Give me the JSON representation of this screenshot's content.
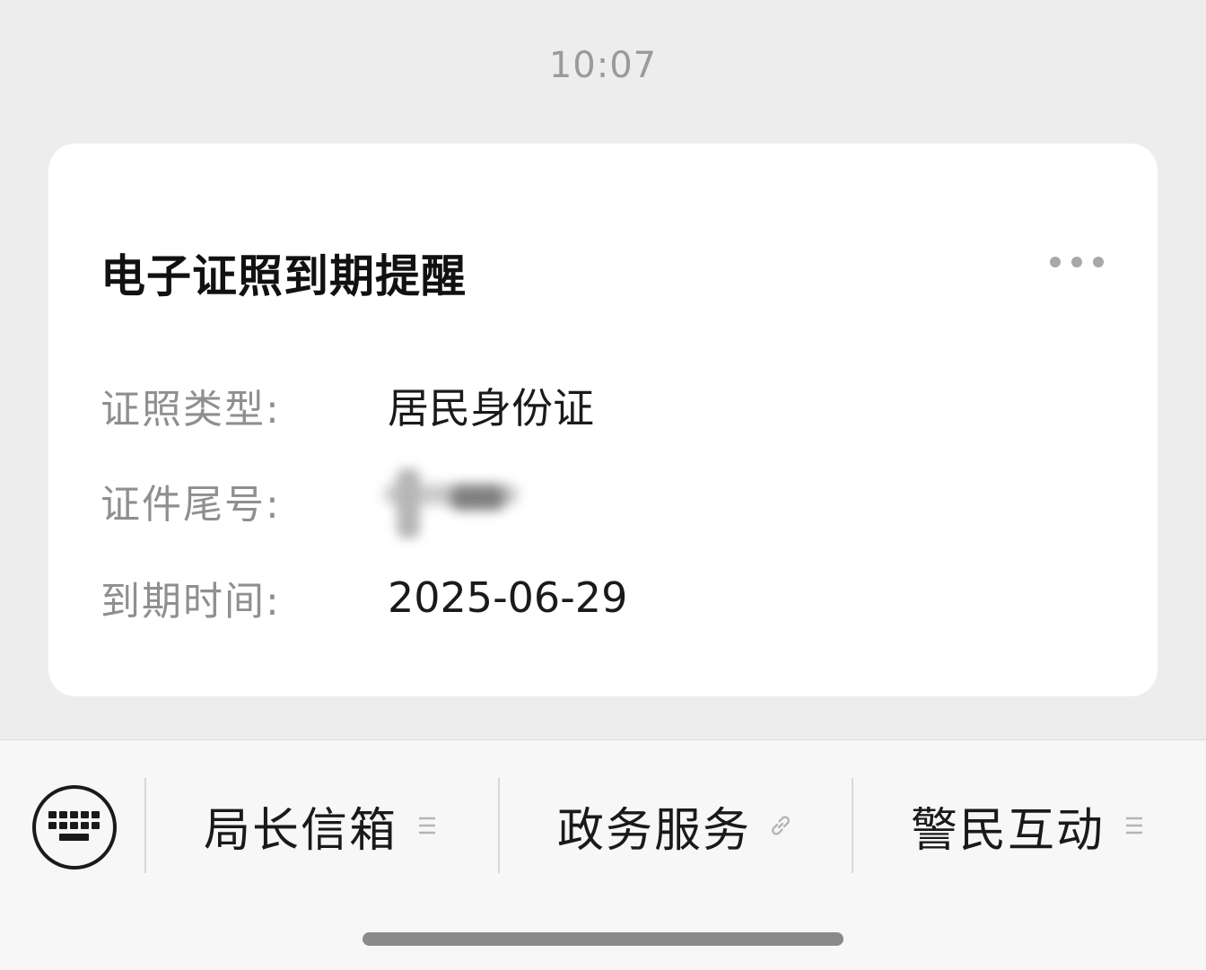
{
  "timestamp": "10:07",
  "card": {
    "title": "电子证照到期提醒",
    "more_icon": "more-horizontal-icon",
    "fields": [
      {
        "label": "证照类型:",
        "value": "居民身份证"
      },
      {
        "label": "证件尾号:",
        "value": ""
      },
      {
        "label": "到期时间:",
        "value": "2025-06-29"
      }
    ]
  },
  "bottom_menu": {
    "keyboard_icon": "keyboard-icon",
    "items": [
      {
        "label": "局长信箱",
        "icon": "submenu-lines-icon"
      },
      {
        "label": "政务服务",
        "icon": "link-icon"
      },
      {
        "label": "警民互动",
        "icon": "submenu-lines-icon"
      }
    ]
  },
  "colors": {
    "background": "#ededed",
    "card": "#ffffff",
    "label": "#8f8f8f",
    "text": "#1a1a1a"
  }
}
